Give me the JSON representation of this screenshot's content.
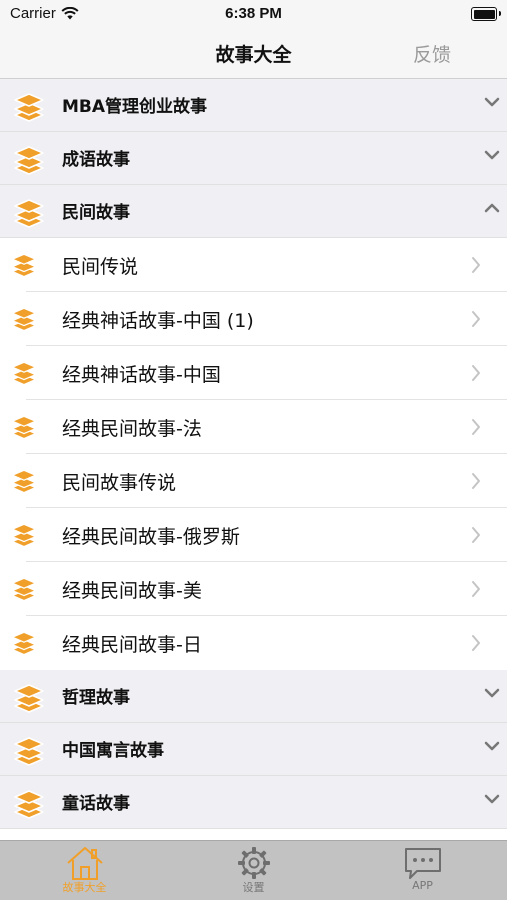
{
  "status_bar": {
    "carrier": "Carrier",
    "time": "6:38 PM"
  },
  "nav": {
    "title": "故事大全",
    "feedback": "反馈"
  },
  "colors": {
    "accent": "#f0a02a",
    "section_bg": "#efeff4",
    "tabbar_bg": "#c2c2c2"
  },
  "sections": [
    {
      "label": "MBA管理创业故事",
      "expanded": false
    },
    {
      "label": "成语故事",
      "expanded": false
    },
    {
      "label": "民间故事",
      "expanded": true,
      "items": [
        "民间传说",
        "经典神话故事-中国 (1)",
        "经典神话故事-中国",
        "经典民间故事-法",
        "民间故事传说",
        "经典民间故事-俄罗斯",
        "经典民间故事-美",
        "经典民间故事-日"
      ]
    },
    {
      "label": "哲理故事",
      "expanded": false
    },
    {
      "label": "中国寓言故事",
      "expanded": false
    },
    {
      "label": "童话故事",
      "expanded": false
    }
  ],
  "tabs": [
    {
      "label": "故事大全",
      "icon": "house-icon",
      "active": true
    },
    {
      "label": "设置",
      "icon": "gear-icon",
      "active": false
    },
    {
      "label": "APP",
      "icon": "chat-bubble-icon",
      "active": false
    }
  ]
}
